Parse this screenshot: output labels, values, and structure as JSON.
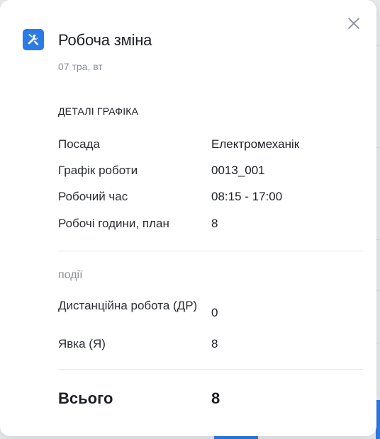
{
  "card": {
    "title": "Робоча зміна",
    "subtitle": "07 тра, вт",
    "accent_color": "#2c7be5",
    "icon": "tools-icon"
  },
  "schedule": {
    "section_title": "ДЕТАЛІ ГРАФІКА",
    "rows": [
      {
        "label": "Посада",
        "value": "Електромеханік"
      },
      {
        "label": "Графік роботи",
        "value": "0013_001"
      },
      {
        "label": "Робочий час",
        "value": "08:15 - 17:00"
      },
      {
        "label": "Робочі години, план",
        "value": "8"
      }
    ]
  },
  "events": {
    "section_title": "ПОДІЇ",
    "rows": [
      {
        "label": "Дистанційна робота (ДР)",
        "value": "0"
      },
      {
        "label": "Явка (Я)",
        "value": "8"
      }
    ]
  },
  "total": {
    "label": "Всього",
    "value": "8"
  }
}
